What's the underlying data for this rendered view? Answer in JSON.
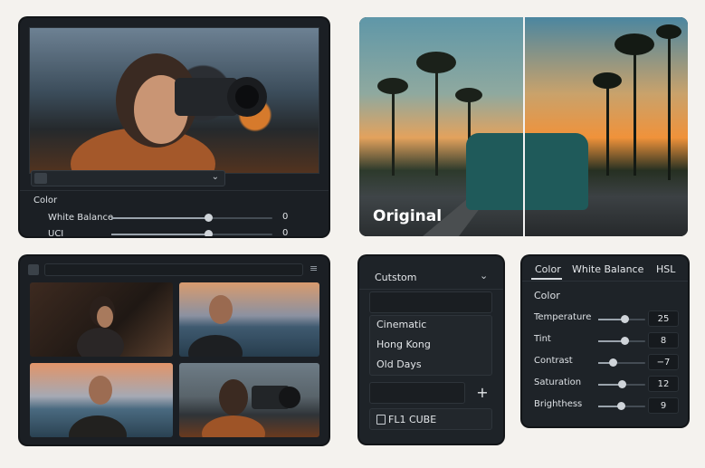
{
  "panel1": {
    "section_title": "Color",
    "sliders": [
      {
        "label": "White Balance",
        "value": "0",
        "level": 0.6
      },
      {
        "label": "UCI",
        "value": "0",
        "level": 0.6
      }
    ]
  },
  "panel2": {
    "overlay_label": "Original"
  },
  "panel4": {
    "preset_dropdown": "Cutstom",
    "presets": [
      "Cinematic",
      "Hong Kong",
      "Old Days"
    ],
    "add_symbol": "+",
    "lut_file": "FL1 CUBE"
  },
  "panel5": {
    "tabs": [
      "Color",
      "White Balance",
      "HSL"
    ],
    "active_tab": "Color",
    "section_title": "Color",
    "sliders": [
      {
        "label": "Temperature",
        "value": "25",
        "level": 0.55
      },
      {
        "label": "Tint",
        "value": "8",
        "level": 0.55
      },
      {
        "label": "Contrast",
        "value": "−7",
        "level": 0.3
      },
      {
        "label": "Saturation",
        "value": "12",
        "level": 0.5
      },
      {
        "label": "Brighthess",
        "value": "9",
        "level": 0.48
      }
    ]
  },
  "icons": {
    "dropdown": "chevron-down-icon",
    "menu": "hamburger-menu-icon",
    "file": "file-icon",
    "layout": "layout-icon"
  }
}
